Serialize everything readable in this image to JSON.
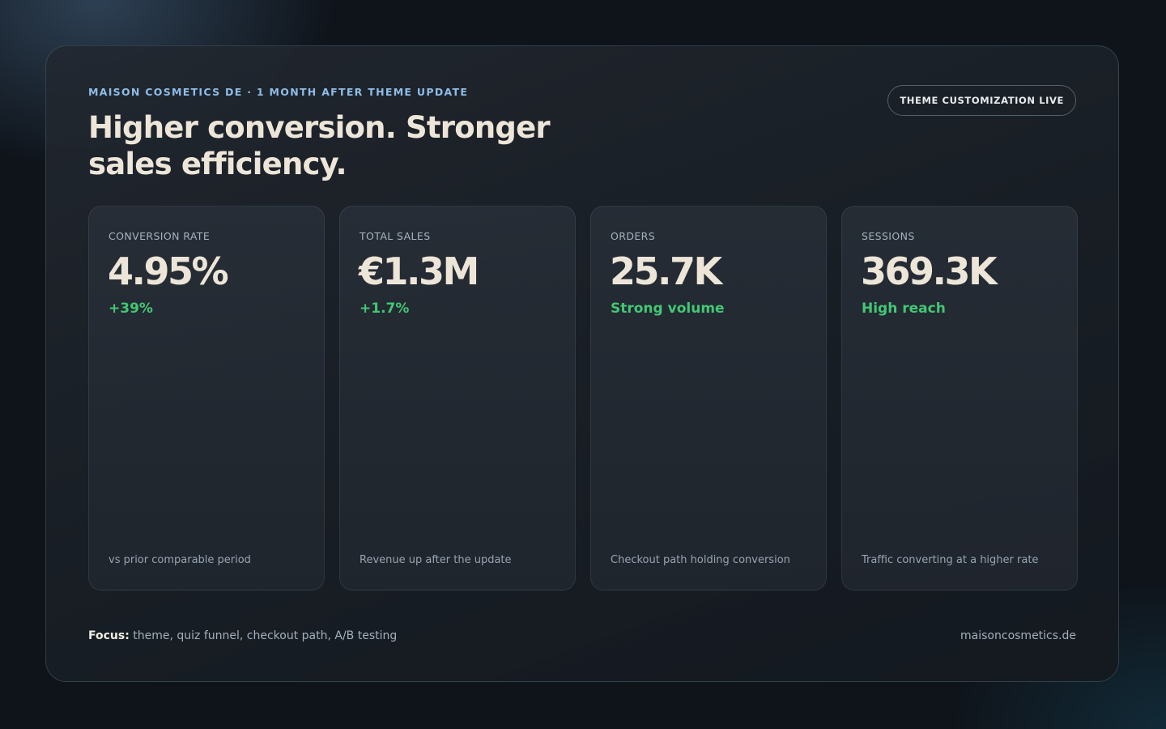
{
  "header": {
    "eyebrow": "MAISON COSMETICS DE · 1 MONTH AFTER THEME UPDATE",
    "headline": "Higher conversion. Stronger sales efficiency.",
    "badge": "THEME CUSTOMIZATION LIVE"
  },
  "cards": [
    {
      "label": "CONVERSION RATE",
      "value": "4.95%",
      "delta": "+39%",
      "footnote": "vs prior comparable period"
    },
    {
      "label": "TOTAL SALES",
      "value": "€1.3M",
      "delta": "+1.7%",
      "footnote": "Revenue up after the update"
    },
    {
      "label": "ORDERS",
      "value": "25.7K",
      "delta": "Strong volume",
      "footnote": "Checkout path holding conversion"
    },
    {
      "label": "SESSIONS",
      "value": "369.3K",
      "delta": "High reach",
      "footnote": "Traffic converting at a higher rate"
    }
  ],
  "footer": {
    "focus_label": "Focus:",
    "focus_text": "theme, quiz funnel, checkout path, A/B testing",
    "site": "maisoncosmetics.de"
  },
  "colors": {
    "accent_blue": "#8fbde6",
    "positive_green": "#43c774",
    "headline_cream": "#ede6d8",
    "background": "#0f141b"
  }
}
